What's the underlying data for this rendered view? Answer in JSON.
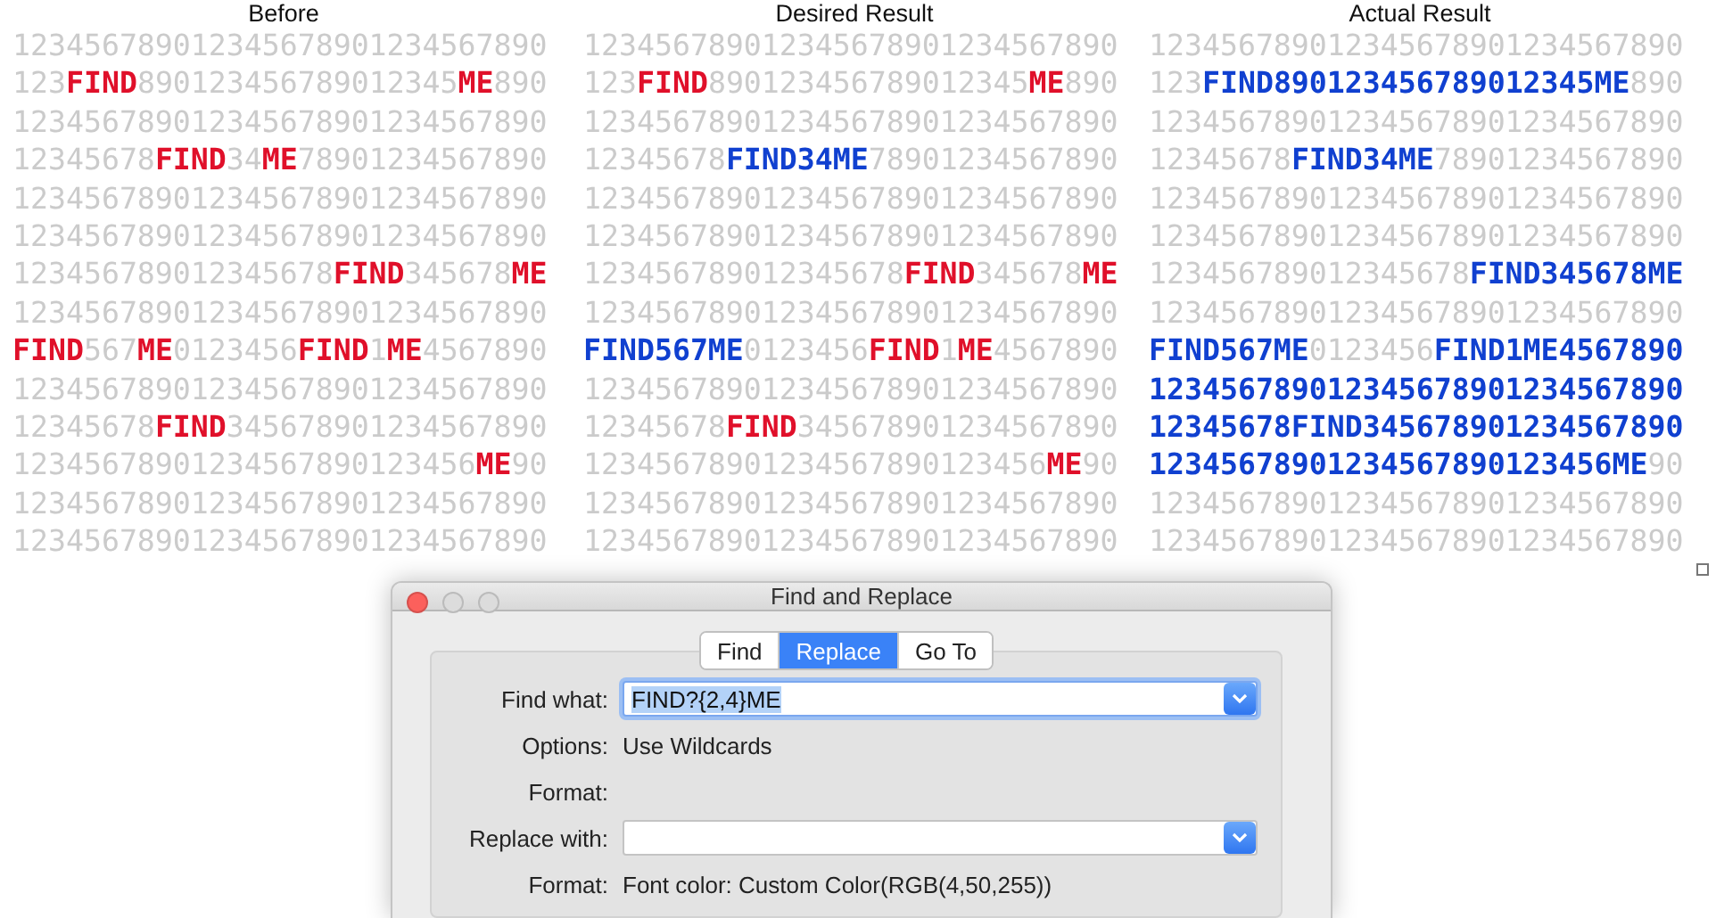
{
  "columns": [
    {
      "title": "Before",
      "lines": [
        [
          {
            "kind": "plain",
            "text": "123456789012345678901234567890"
          }
        ],
        [
          {
            "kind": "plain",
            "text": "123"
          },
          {
            "kind": "match",
            "text": "FIND"
          },
          {
            "kind": "plain",
            "text": "890123456789012345"
          },
          {
            "kind": "match",
            "text": "ME"
          },
          {
            "kind": "plain",
            "text": "890"
          }
        ],
        [
          {
            "kind": "plain",
            "text": "123456789012345678901234567890"
          }
        ],
        [
          {
            "kind": "plain",
            "text": "12345678"
          },
          {
            "kind": "match",
            "text": "FIND"
          },
          {
            "kind": "plain",
            "text": "34"
          },
          {
            "kind": "match",
            "text": "ME"
          },
          {
            "kind": "plain",
            "text": "78901234567890"
          }
        ],
        [
          {
            "kind": "plain",
            "text": "123456789012345678901234567890"
          }
        ],
        [
          {
            "kind": "plain",
            "text": "123456789012345678901234567890"
          }
        ],
        [
          {
            "kind": "plain",
            "text": "123456789012345678"
          },
          {
            "kind": "match",
            "text": "FIND"
          },
          {
            "kind": "plain",
            "text": "345678"
          },
          {
            "kind": "match",
            "text": "ME"
          }
        ],
        [
          {
            "kind": "plain",
            "text": "123456789012345678901234567890"
          }
        ],
        [
          {
            "kind": "match",
            "text": "FIND"
          },
          {
            "kind": "plain",
            "text": "567"
          },
          {
            "kind": "match",
            "text": "ME"
          },
          {
            "kind": "plain",
            "text": "0123456"
          },
          {
            "kind": "match",
            "text": "FIND"
          },
          {
            "kind": "plain",
            "text": "1"
          },
          {
            "kind": "match",
            "text": "ME"
          },
          {
            "kind": "plain",
            "text": "4567890"
          }
        ],
        [
          {
            "kind": "plain",
            "text": "123456789012345678901234567890"
          }
        ],
        [
          {
            "kind": "plain",
            "text": "12345678"
          },
          {
            "kind": "match",
            "text": "FIND"
          },
          {
            "kind": "plain",
            "text": "345678901234567890"
          }
        ],
        [
          {
            "kind": "plain",
            "text": "12345678901234567890123456"
          },
          {
            "kind": "match",
            "text": "ME"
          },
          {
            "kind": "plain",
            "text": "90"
          }
        ],
        [
          {
            "kind": "plain",
            "text": "123456789012345678901234567890"
          }
        ],
        [
          {
            "kind": "plain",
            "text": "123456789012345678901234567890"
          }
        ]
      ]
    },
    {
      "title": "Desired Result",
      "lines": [
        [
          {
            "kind": "plain",
            "text": "123456789012345678901234567890"
          }
        ],
        [
          {
            "kind": "plain",
            "text": "123"
          },
          {
            "kind": "match",
            "text": "FIND"
          },
          {
            "kind": "plain",
            "text": "890123456789012345"
          },
          {
            "kind": "match",
            "text": "ME"
          },
          {
            "kind": "plain",
            "text": "890"
          }
        ],
        [
          {
            "kind": "plain",
            "text": "123456789012345678901234567890"
          }
        ],
        [
          {
            "kind": "plain",
            "text": "12345678"
          },
          {
            "kind": "replaced",
            "text": "FIND34ME"
          },
          {
            "kind": "plain",
            "text": "78901234567890"
          }
        ],
        [
          {
            "kind": "plain",
            "text": "123456789012345678901234567890"
          }
        ],
        [
          {
            "kind": "plain",
            "text": "123456789012345678901234567890"
          }
        ],
        [
          {
            "kind": "plain",
            "text": "123456789012345678"
          },
          {
            "kind": "match",
            "text": "FIND"
          },
          {
            "kind": "plain",
            "text": "345678"
          },
          {
            "kind": "match",
            "text": "ME"
          }
        ],
        [
          {
            "kind": "plain",
            "text": "123456789012345678901234567890"
          }
        ],
        [
          {
            "kind": "replaced",
            "text": "FIND567ME"
          },
          {
            "kind": "plain",
            "text": "0123456"
          },
          {
            "kind": "match",
            "text": "FIND"
          },
          {
            "kind": "plain",
            "text": "1"
          },
          {
            "kind": "match",
            "text": "ME"
          },
          {
            "kind": "plain",
            "text": "4567890"
          }
        ],
        [
          {
            "kind": "plain",
            "text": "123456789012345678901234567890"
          }
        ],
        [
          {
            "kind": "plain",
            "text": "12345678"
          },
          {
            "kind": "match",
            "text": "FIND"
          },
          {
            "kind": "plain",
            "text": "345678901234567890"
          }
        ],
        [
          {
            "kind": "plain",
            "text": "12345678901234567890123456"
          },
          {
            "kind": "match",
            "text": "ME"
          },
          {
            "kind": "plain",
            "text": "90"
          }
        ],
        [
          {
            "kind": "plain",
            "text": "123456789012345678901234567890"
          }
        ],
        [
          {
            "kind": "plain",
            "text": "123456789012345678901234567890"
          }
        ]
      ]
    },
    {
      "title": "Actual Result",
      "lines": [
        [
          {
            "kind": "plain",
            "text": "123456789012345678901234567890"
          }
        ],
        [
          {
            "kind": "plain",
            "text": "123"
          },
          {
            "kind": "replaced",
            "text": "FIND890123456789012345ME"
          },
          {
            "kind": "plain",
            "text": "890"
          }
        ],
        [
          {
            "kind": "plain",
            "text": "123456789012345678901234567890"
          }
        ],
        [
          {
            "kind": "plain",
            "text": "12345678"
          },
          {
            "kind": "replaced",
            "text": "FIND34ME"
          },
          {
            "kind": "plain",
            "text": "78901234567890"
          }
        ],
        [
          {
            "kind": "plain",
            "text": "123456789012345678901234567890"
          }
        ],
        [
          {
            "kind": "plain",
            "text": "123456789012345678901234567890"
          }
        ],
        [
          {
            "kind": "plain",
            "text": "123456789012345678"
          },
          {
            "kind": "replaced",
            "text": "FIND345678ME"
          }
        ],
        [
          {
            "kind": "plain",
            "text": "123456789012345678901234567890"
          }
        ],
        [
          {
            "kind": "replaced",
            "text": "FIND567ME"
          },
          {
            "kind": "plain",
            "text": "0123456"
          },
          {
            "kind": "replaced",
            "text": "FIND1ME4567890"
          }
        ],
        [
          {
            "kind": "replaced",
            "text": "123456789012345678901234567890"
          }
        ],
        [
          {
            "kind": "replaced",
            "text": "12345678FIND345678901234567890"
          }
        ],
        [
          {
            "kind": "replaced",
            "text": "12345678901234567890123456ME"
          },
          {
            "kind": "plain",
            "text": "90"
          }
        ],
        [
          {
            "kind": "plain",
            "text": "123456789012345678901234567890"
          }
        ],
        [
          {
            "kind": "plain",
            "text": "123456789012345678901234567890"
          }
        ]
      ]
    }
  ],
  "dialog": {
    "title": "Find and Replace",
    "tabs": [
      {
        "label": "Find",
        "selected": false
      },
      {
        "label": "Replace",
        "selected": true
      },
      {
        "label": "Go To",
        "selected": false
      }
    ],
    "rows": [
      {
        "kind": "combo",
        "label": "Find what:",
        "value": "FIND?{2,4}ME",
        "focused": true,
        "text_selected": true
      },
      {
        "kind": "text",
        "label": "Options:",
        "value": "Use Wildcards"
      },
      {
        "kind": "text",
        "label": "Format:"
      },
      {
        "kind": "combo",
        "label": "Replace with:",
        "focused": false
      },
      {
        "kind": "text",
        "label": "Format:",
        "value": "Font color: Custom Color(RGB(4,50,255))"
      }
    ]
  }
}
